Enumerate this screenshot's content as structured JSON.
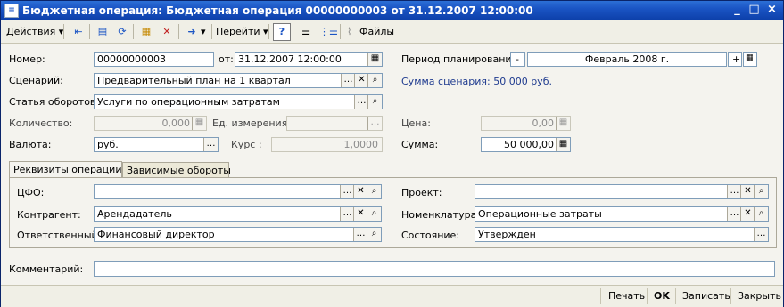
{
  "window": {
    "title": "Бюджетная операция: Бюджетная операция 00000000003 от 31.12.2007 12:00:00"
  },
  "toolbar": {
    "actions": "Действия",
    "goto": "Перейти",
    "files": "Файлы",
    "help": "?"
  },
  "form": {
    "number_label": "Номер:",
    "number_value": "00000000003",
    "date_label": "от:",
    "date_value": "31.12.2007 12:00:00",
    "period_label": "Период планирования:",
    "period_value": "Февраль 2008 г.",
    "period_minus": "-",
    "period_plus": "+",
    "scenario_label": "Сценарий:",
    "scenario_value": "Предварительный план на 1 квартал",
    "scenario_sum": "Сумма сценария: 50 000 руб.",
    "article_label": "Статья оборотов:",
    "article_value": "Услуги по операционным затратам",
    "qty_label": "Количество:",
    "qty_value": "0,000",
    "unit_label": "Ед. измерения:",
    "unit_value": "",
    "price_label": "Цена:",
    "price_value": "0,00",
    "currency_label": "Валюта:",
    "currency_value": "руб.",
    "rate_label": "Курс :",
    "rate_value": "1,0000",
    "sum_label": "Сумма:",
    "sum_value": "50 000,00"
  },
  "tabs": [
    {
      "label": "Реквизиты операции"
    },
    {
      "label": "Зависимые обороты"
    }
  ],
  "panel": {
    "cfo_label": "ЦФО:",
    "cfo_value": "",
    "project_label": "Проект:",
    "project_value": "",
    "counterparty_label": "Контрагент:",
    "counterparty_value": "Арендадатель",
    "nomenclature_label": "Номенклатура:",
    "nomenclature_value": "Операционные затраты",
    "responsible_label": "Ответственный:",
    "responsible_value": "Финансовый директор",
    "state_label": "Состояние:",
    "state_value": "Утвержден"
  },
  "comment": {
    "label": "Комментарий:",
    "value": ""
  },
  "footer": {
    "print": "Печать",
    "ok": "OK",
    "save": "Записать",
    "close": "Закрыть"
  },
  "colors": {
    "title_bar": "#1a54c4",
    "link_text": "#1f3b8f"
  }
}
